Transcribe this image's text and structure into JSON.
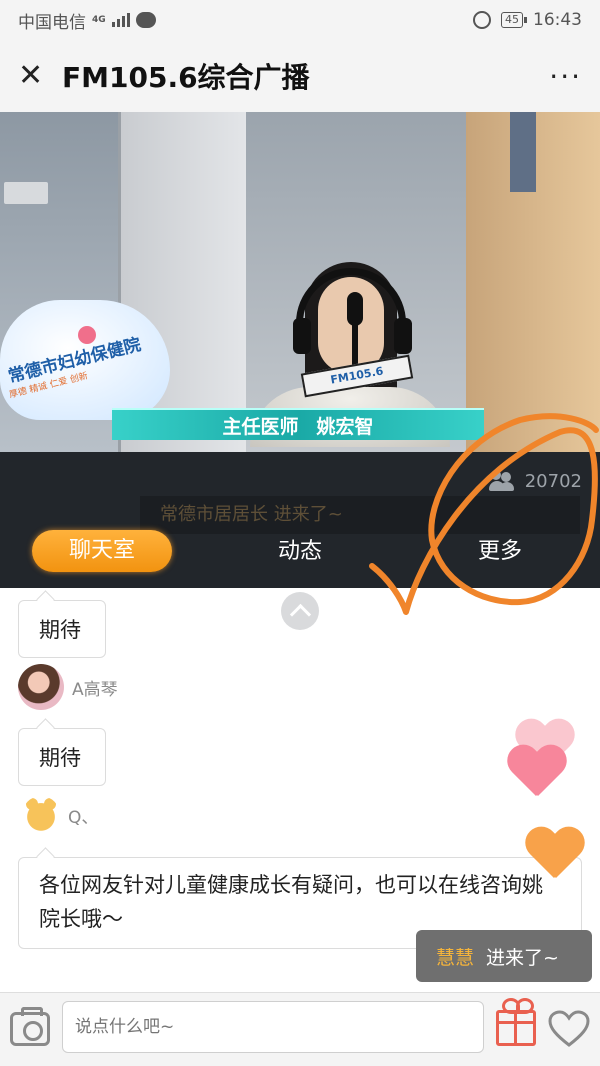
{
  "status_bar": {
    "carrier": "中国电信",
    "network": "4G",
    "battery": "45",
    "time": "16:43"
  },
  "header": {
    "title": "FM105.6综合广播",
    "close_icon": "close-icon",
    "more_icon": "more-dots-icon"
  },
  "video": {
    "caption_role": "主任医师",
    "caption_name": "姚宏智",
    "hospital_sign": "常德市妇幼保健院",
    "hospital_sub": "厚德 精诚 仁爱 创新",
    "mic_flag": "FM105.6",
    "viewer_count": "20702",
    "ticker_text": "常德市居居长 进来了~"
  },
  "tabs": [
    {
      "label": "聊天室",
      "active": true
    },
    {
      "label": "动态",
      "active": false
    },
    {
      "label": "更多",
      "active": false
    }
  ],
  "chat": {
    "messages": [
      {
        "text": "期待"
      },
      {
        "user": "A高琴",
        "text": "期待"
      },
      {
        "user": "Q、",
        "text": "各位网友针对儿童健康成长有疑问，也可以在线咨询姚院长哦～"
      }
    ]
  },
  "toast": {
    "name": "慧慧",
    "message": "进来了~"
  },
  "input_bar": {
    "placeholder": "说点什么吧~"
  },
  "colors": {
    "accent": "#f29310",
    "scribble": "#f0852b",
    "caption_bar": "#1aa9a6",
    "dark_strip": "#22262b"
  }
}
